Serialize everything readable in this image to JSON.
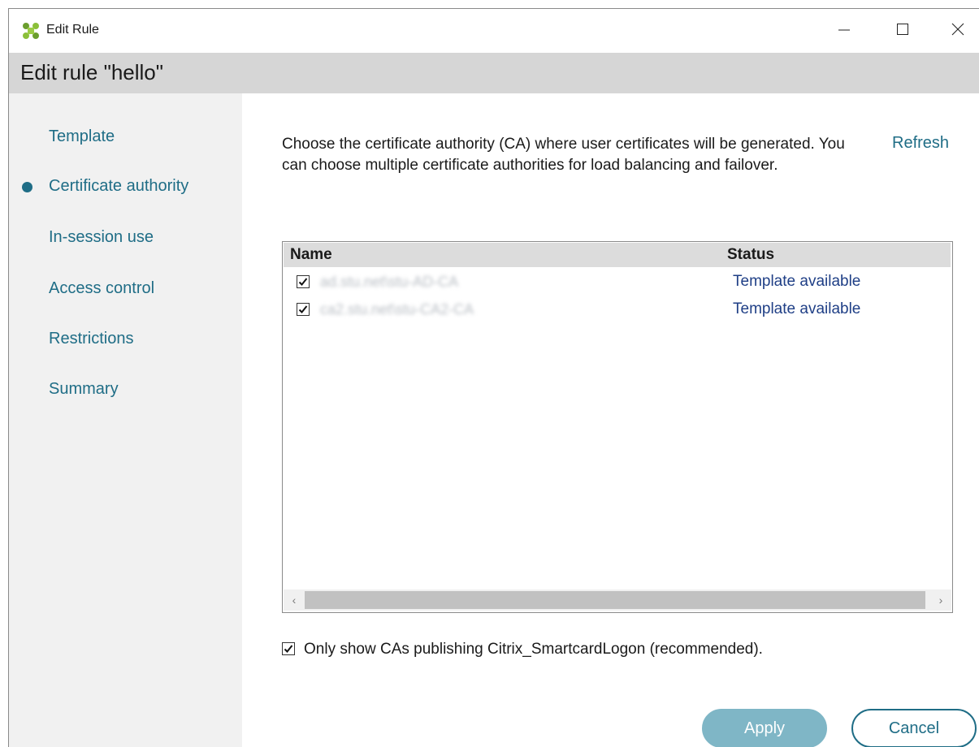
{
  "window": {
    "title": "Edit Rule",
    "app_icon": "citrix-logo-icon",
    "controls": {
      "minimize_icon": "minimize-icon",
      "maximize_icon": "maximize-icon",
      "close_icon": "close-icon"
    }
  },
  "header": {
    "title": "Edit rule \"hello\""
  },
  "sidebar": {
    "items": [
      {
        "label": "Template",
        "active": false
      },
      {
        "label": "Certificate authority",
        "active": true
      },
      {
        "label": "In-session use",
        "active": false
      },
      {
        "label": "Access control",
        "active": false
      },
      {
        "label": "Restrictions",
        "active": false
      },
      {
        "label": "Summary",
        "active": false
      }
    ]
  },
  "main": {
    "description": "Choose the certificate authority (CA) where user certificates will be generated. You can choose multiple certificate authorities for load balancing and failover.",
    "refresh_label": "Refresh",
    "table": {
      "columns": {
        "name": "Name",
        "status": "Status"
      },
      "rows": [
        {
          "name": "ad.stu.net\\stu-AD-CA",
          "status": "Template available",
          "checked": true
        },
        {
          "name": "ca2.stu.net\\stu-CA2-CA",
          "status": "Template available",
          "checked": true
        }
      ],
      "scroll_left": "‹",
      "scroll_right": "›"
    },
    "only_show": {
      "label": "Only show CAs publishing Citrix_SmartcardLogon (recommended).",
      "checked": true
    }
  },
  "buttons": {
    "apply": "Apply",
    "cancel": "Cancel"
  },
  "colors": {
    "accent": "#1f6d86",
    "apply_bg": "#7fb6c6",
    "header_bg": "#d6d6d6",
    "sidebar_bg": "#f1f1f1",
    "status_text": "#1f3f86"
  }
}
